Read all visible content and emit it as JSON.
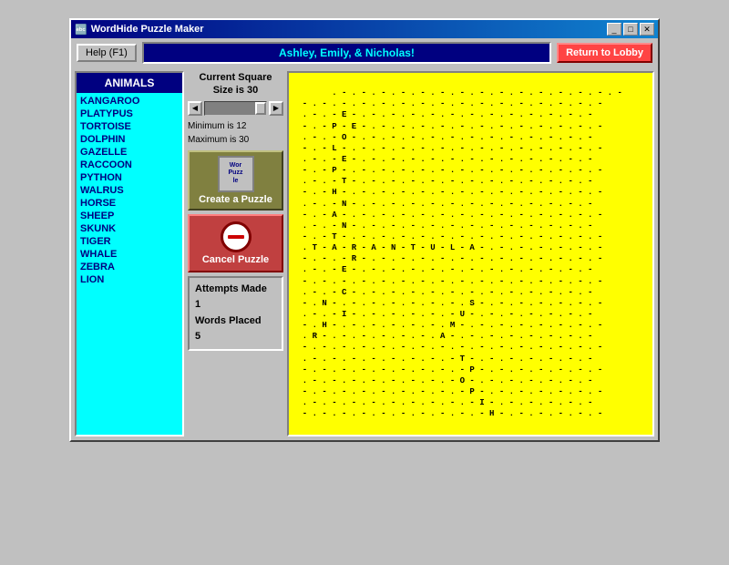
{
  "titleBar": {
    "icon": "puzzle-icon",
    "title": "WordHide Puzzle Maker",
    "minBtn": "_",
    "maxBtn": "□",
    "closeBtn": "✕"
  },
  "topBar": {
    "helpLabel": "Help (F1)",
    "nameDisplay": "Ashley, Emily, & Nicholas!",
    "lobbyLabel": "Return to Lobby"
  },
  "wordList": {
    "header": "ANIMALS",
    "words": [
      "KANGAROO",
      "PLATYPUS",
      "TORTOISE",
      "DOLPHIN",
      "GAZELLE",
      "RACCOON",
      "PYTHON",
      "WALRUS",
      "HORSE",
      "SHEEP",
      "SKUNK",
      "TIGER",
      "WHALE",
      "ZEBRA",
      "LION"
    ]
  },
  "controls": {
    "squareSizeLabel": "Current Square\nSize is 30",
    "minLabel": "Minimum is 12",
    "maxLabel": "Maximum is 30",
    "createLabel": "Create a Puzzle",
    "puzzleIconLine1": "Wor",
    "puzzleIconLine2": "Puzz",
    "puzzleIconLine3": "le",
    "cancelLabel": "Cancel Puzzle"
  },
  "stats": {
    "attemptsLabel": "Attempts Made",
    "attemptsValue": "1",
    "wordsLabel": "Words Placed",
    "wordsValue": "5"
  },
  "grid": {
    "content": "  . - . - . - . - . - . - . - . - . - . - . - . - . - . - . -\n  - . - . - . - . - . - . - . - . - . - . - . - . - . - . - . -\n  . - . - E - . - . - . - . - . - . - . - . - . - . - . - . -\n  - . - P - E - . - . - . - . - . - . - . - . - . - . - . - . -\n  . - . - O - . - . - . - . - . - . - . - . - . - . - . - . -\n  - . - L - . - . - . - . - . - . - . - . - . - . - . - . - . -\n  . - . - E - . - . - . - . - . - . - . - . - . - . - . - . -\n  - . - P - . - . - . - . - . - . - . - . - . - . - . - . - . -\n  . - . - T - . - . - . - . - . - . - . - . - . - . - . - . -\n  - . - H - . - . - . - . - . - . - . - . - . - . - . - . - . -\n  . - . - N - . - . - . - . - . - . - . - . - . - . - . - . -\n  - . - A - . - . - . - . - . - . - . - . - . - . - . - . - . -\n  . - . - N - . - . - . - . - . - . - . - . - . - . - . - . -\n  - . - T - . - . - . - . - . - . - . - . - . - . - . - . - . -\n  . T - A - R - A - N - T - U - L - A - . - . - . - . - . - . -\n  - . - . - R - . - . - . - . - . - . - . - . - . - . - . - . -\n  . - . - E - . - . - . - . - . - . - . - . - . - . - . - . -\n  - . - . - . - . - . - . - . - . - . - . - . - . - . - . - . -\n  . - . - C - . - . - . - . - . - . - . - . - . - . - . - . -\n  - . N - . - . - . - . - . - . - . S - . - . - . - . - . - . -\n  . - . - I - . - . - . - . - . - U - . - . - . - . - . - . -\n  - . H - . - . - . - . - . - . M - . - . - . - . - . - . - . -\n  . R - . - . - . - . - . - . A - . - . - . - . - . - . - . -\n  - . - . - . - . - . - . - . - . - . - . - . - . - . - . - . -\n  . - . - . - . - . - . - . - . - T - . - . - . - . - . - . -\n  - . - . - . - . - . - . - . - . - P - . - . - . - . - . - . -\n  . - . - . - . - . - . - . - . - O - . - . - . - . - . - . -\n  - . - . - . - . - . - . - . - . - P - . - . - . - . - . - . -\n  . - . - . - . - . - . - . - . - . - I - . - . - . - . - . -\n  - . - . - . - . - . - . - . - . - . - H - . - . - . - . - . -"
  }
}
